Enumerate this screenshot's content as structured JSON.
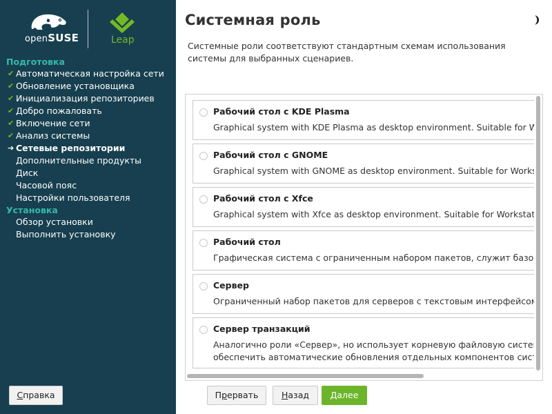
{
  "branding": {
    "opensuse_light": "open",
    "opensuse_bold": "SUSE",
    "leap": "Leap",
    "brand_green": "#73ba25",
    "sidebar_bg": "#173f4f",
    "heading_teal": "#35b9ab"
  },
  "sidebar": {
    "sections": [
      {
        "heading": "Подготовка",
        "steps": [
          {
            "label": "Автоматическая настройка сети",
            "status": "done"
          },
          {
            "label": "Обновление установщика",
            "status": "done"
          },
          {
            "label": "Инициализация репозиториев",
            "status": "done"
          },
          {
            "label": "Добро пожаловать",
            "status": "done"
          },
          {
            "label": "Включение сети",
            "status": "done"
          },
          {
            "label": "Анализ системы",
            "status": "done"
          },
          {
            "label": "Сетевые репозитории",
            "status": "current"
          },
          {
            "label": "Дополнительные продукты",
            "status": "pending"
          },
          {
            "label": "Диск",
            "status": "pending"
          },
          {
            "label": "Часовой пояс",
            "status": "pending"
          },
          {
            "label": "Настройки пользователя",
            "status": "pending"
          }
        ]
      },
      {
        "heading": "Установка",
        "steps": [
          {
            "label": "Обзор установки",
            "status": "pending"
          },
          {
            "label": "Выполнить установку",
            "status": "pending"
          }
        ]
      }
    ]
  },
  "page": {
    "title": "Системная роль",
    "description": "Системные роли соответствуют стандартным схемам использования системы для выбранных сценариев.",
    "theme_icon": "half-moon-icon"
  },
  "roles": [
    {
      "title": "Рабочий стол с KDE Plasma",
      "desc": "Graphical system with KDE Plasma as desktop environment. Suitable for Workstations, Desktops and Laptops.",
      "selected": false
    },
    {
      "title": "Рабочий стол с GNOME",
      "desc": "Graphical system with GNOME as desktop environment. Suitable for Workstations, Desktops and Laptops.",
      "selected": false
    },
    {
      "title": "Рабочий стол с Xfce",
      "desc": "Graphical system with Xfce as desktop environment. Suitable for Workstations, Desktops and Laptops.",
      "selected": false
    },
    {
      "title": "Рабочий стол",
      "desc": "Графическая система с ограниченным набором пакетов, служит базой для ручной настройки.",
      "selected": false
    },
    {
      "title": "Сервер",
      "desc": "Ограниченный набор пакетов для серверов с текстовым интерфейсом.",
      "selected": false
    },
    {
      "title": "Сервер транзакций",
      "desc": "Аналогично роли «Сервер», но использует корневую файловую систему, доступную только для чтения, чтобы",
      "desc2": "обеспечить автоматические обновления отдельных компонентов системы, которые можно откатить.",
      "selected": false
    }
  ],
  "buttons": {
    "help": {
      "mnemonic": "С",
      "rest": "правка"
    },
    "abort": {
      "pre": "П",
      "mnemonic": "р",
      "rest": "ервать"
    },
    "back": {
      "mnemonic": "Н",
      "rest": "азад"
    },
    "next": {
      "label": "Далее"
    }
  }
}
